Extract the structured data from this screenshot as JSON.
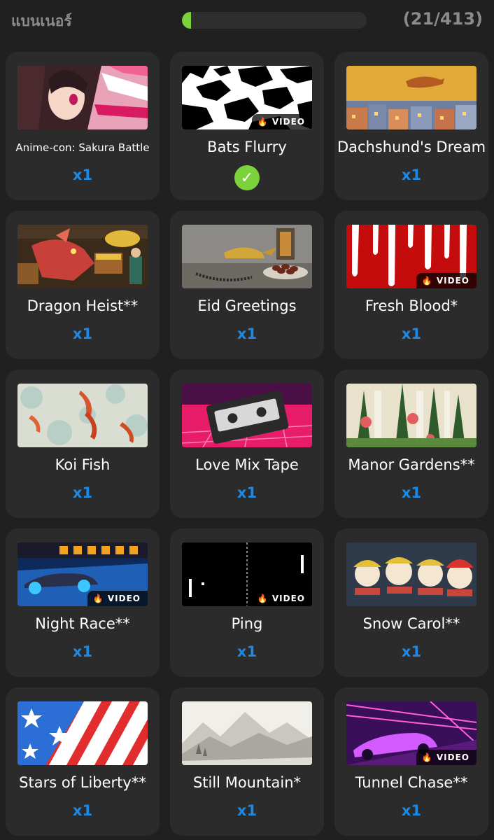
{
  "header": {
    "title": "แบนเนอร์",
    "counter": "(21/413)",
    "progress_fraction": 0.051
  },
  "badge_label": "VIDEO",
  "items": [
    {
      "name": "Anime-con: Sakura Battle",
      "quantity": "x1",
      "video": false,
      "owned": false
    },
    {
      "name": "Bats Flurry",
      "quantity": "",
      "video": true,
      "owned": true
    },
    {
      "name": "Dachshund's Dream",
      "quantity": "x1",
      "video": false,
      "owned": false
    },
    {
      "name": "Dragon Heist**",
      "quantity": "x1",
      "video": false,
      "owned": false
    },
    {
      "name": "Eid Greetings",
      "quantity": "x1",
      "video": false,
      "owned": false
    },
    {
      "name": "Fresh Blood*",
      "quantity": "x1",
      "video": true,
      "owned": false
    },
    {
      "name": "Koi Fish",
      "quantity": "x1",
      "video": false,
      "owned": false
    },
    {
      "name": "Love Mix Tape",
      "quantity": "x1",
      "video": false,
      "owned": false
    },
    {
      "name": "Manor Gardens**",
      "quantity": "x1",
      "video": false,
      "owned": false
    },
    {
      "name": "Night Race**",
      "quantity": "x1",
      "video": true,
      "owned": false
    },
    {
      "name": "Ping",
      "quantity": "x1",
      "video": true,
      "owned": false
    },
    {
      "name": "Snow Carol**",
      "quantity": "x1",
      "video": false,
      "owned": false
    },
    {
      "name": "Stars of Liberty**",
      "quantity": "x1",
      "video": false,
      "owned": false
    },
    {
      "name": "Still Mountain*",
      "quantity": "x1",
      "video": false,
      "owned": false
    },
    {
      "name": "Tunnel Chase**",
      "quantity": "x1",
      "video": true,
      "owned": false
    }
  ],
  "colors": {
    "background": "#202020",
    "card": "#2b2b2b",
    "accent_blue": "#1e88e5",
    "progress_green": "#7bd23a"
  }
}
